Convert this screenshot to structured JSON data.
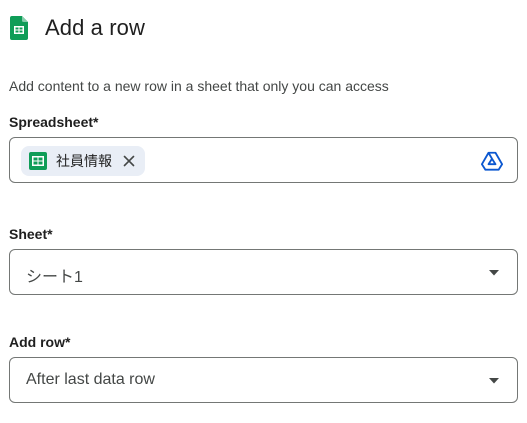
{
  "header": {
    "title": "Add a row",
    "icon": "google-sheets-icon"
  },
  "description": "Add content to a new row in a sheet that only you can access",
  "spreadsheet": {
    "label": "Spreadsheet*",
    "chip_label": "社員情報",
    "chip_icon": "google-sheets-icon",
    "remove_icon": "close-icon",
    "picker_icon": "google-drive-icon"
  },
  "sheet": {
    "label": "Sheet*",
    "value": "シート1"
  },
  "add_row": {
    "label": "Add row*",
    "value": "After last data row"
  },
  "colors": {
    "sheets_green": "#0f9d58",
    "drive_blue": "#0b57d0",
    "field_border": "#747775",
    "chip_background": "#e9eef6"
  }
}
